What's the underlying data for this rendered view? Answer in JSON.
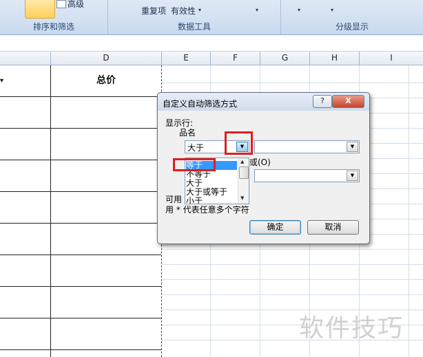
{
  "ribbon": {
    "top_left_btn": "高级",
    "sort_filter_label": "排序和筛选",
    "remove_dup": "重复项",
    "validity": "有效性",
    "data_tools_label": "数据工具",
    "outline_label": "分级显示"
  },
  "columns": [
    "D",
    "E",
    "F",
    "G",
    "H",
    "I"
  ],
  "cell": {
    "header_text": "总价"
  },
  "dialog": {
    "title": "自定义自动筛选方式",
    "help": "?",
    "close": "X",
    "show_rows": "显示行:",
    "field": "品名",
    "op1_value": "大于",
    "or_label": "或(O)",
    "list_items": [
      "等于",
      "不等于",
      "大于",
      "大于或等于",
      "小于"
    ],
    "hint_prefix": "可用",
    "hint_line2": "用 * 代表任意多个字符",
    "ok": "确定",
    "cancel": "取消"
  },
  "watermark": "软件技巧"
}
